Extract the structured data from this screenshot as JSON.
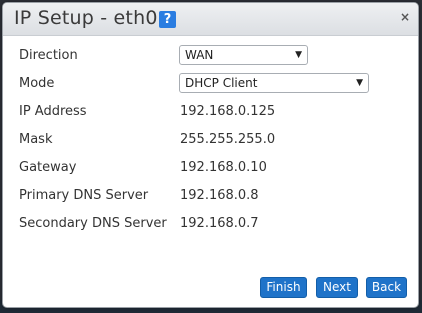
{
  "dialog": {
    "title": "IP Setup - eth0",
    "help_glyph": "?",
    "close_glyph": "×"
  },
  "fields": {
    "direction": {
      "label": "Direction",
      "value": "WAN"
    },
    "mode": {
      "label": "Mode",
      "value": "DHCP Client"
    },
    "ip_address": {
      "label": "IP Address",
      "value": "192.168.0.125"
    },
    "mask": {
      "label": "Mask",
      "value": "255.255.255.0"
    },
    "gateway": {
      "label": "Gateway",
      "value": "192.168.0.10"
    },
    "primary_dns": {
      "label": "Primary DNS Server",
      "value": "192.168.0.8"
    },
    "secondary_dns": {
      "label": "Secondary DNS Server",
      "value": "192.168.0.7"
    }
  },
  "select_caret": "▼",
  "buttons": {
    "finish": "Finish",
    "next": "Next",
    "back": "Back"
  },
  "colors": {
    "button_bg": "#1f73c9",
    "help_bg": "#2a7de1",
    "titlebar_bg": "#e4e7ea"
  },
  "icons": {
    "help": "help-icon",
    "close": "close-icon",
    "dropdown": "chevron-down-icon"
  }
}
